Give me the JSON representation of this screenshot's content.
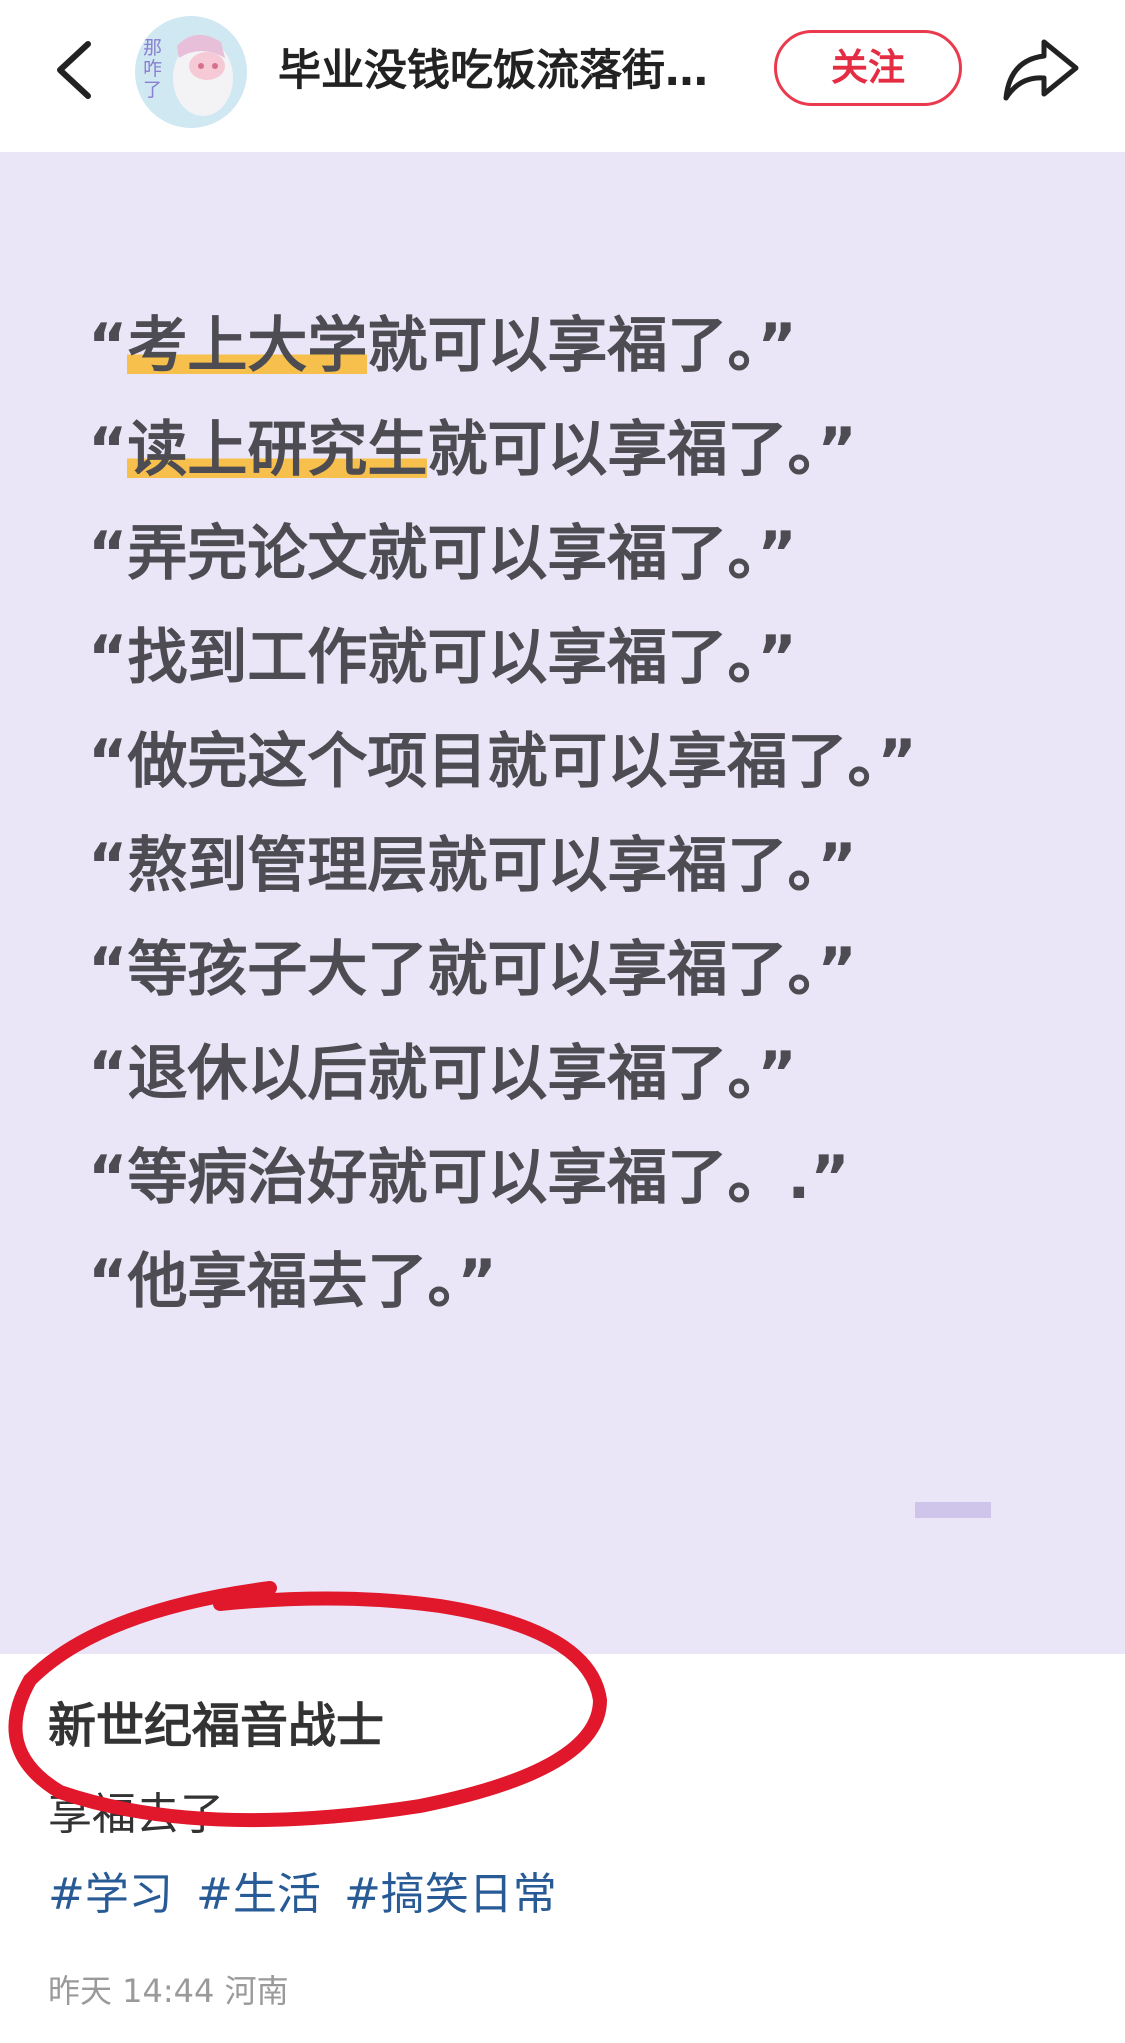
{
  "header": {
    "title": "毕业没钱吃饭流落街…",
    "avatar_text": "那咋了",
    "follow_label": "关注",
    "icons": [
      "back-icon",
      "share-icon"
    ]
  },
  "quotes": [
    {
      "highlight": "考上大学",
      "rest": "就可以享福了。”"
    },
    {
      "highlight": "读上研究生",
      "rest": "就可以享福了。”"
    },
    {
      "highlight": "",
      "rest": "弄完论文就可以享福了。”"
    },
    {
      "highlight": "",
      "rest": "找到工作就可以享福了。”"
    },
    {
      "highlight": "",
      "rest": "做完这个项目就可以享福了。”"
    },
    {
      "highlight": "",
      "rest": "熬到管理层就可以享福了。”"
    },
    {
      "highlight": "",
      "rest": "等孩子大了就可以享福了。”"
    },
    {
      "highlight": "",
      "rest": "退休以后就可以享福了。”"
    },
    {
      "highlight": "",
      "rest": "等病治好就可以享福了。.”"
    },
    {
      "highlight": "",
      "rest": "他享福去了。”"
    }
  ],
  "quote_open": "“",
  "post": {
    "title": "新世纪福音战士",
    "body": "享福去了",
    "tags": [
      "#学习",
      "#生活",
      "#搞笑日常"
    ],
    "meta": "昨天 14:44 河南"
  },
  "colors": {
    "accent_red": "#e42d43",
    "card_bg": "#ebe6f7",
    "highlight": "#f7bf4b",
    "tag_blue": "#285b96"
  }
}
